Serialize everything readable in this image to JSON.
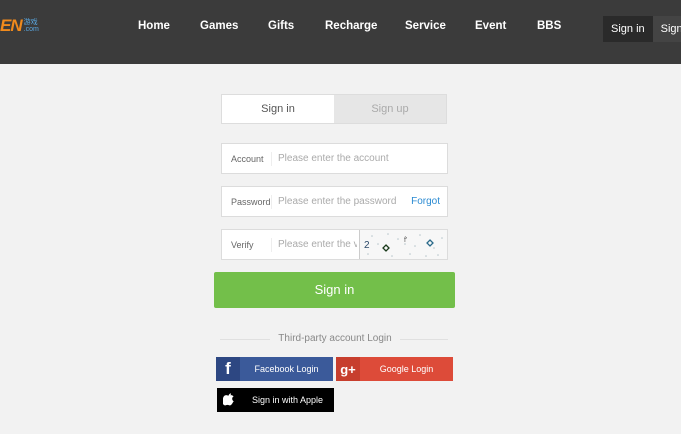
{
  "header": {
    "logo_text": "EN",
    "logo_sub": [
      "游戏",
      ".com"
    ],
    "nav": [
      "Home",
      "Games",
      "Gifts",
      "Recharge",
      "Service",
      "Event",
      "BBS"
    ],
    "signin_label": "Sign in",
    "signup_label": "Sign up"
  },
  "tabs": {
    "signin": "Sign in",
    "signup": "Sign up"
  },
  "form": {
    "account_label": "Account",
    "account_placeholder": "Please enter the account",
    "password_label": "Password",
    "password_placeholder": "Please enter the password",
    "forgot_label": "Forgot",
    "verify_label": "Verify",
    "verify_placeholder": "Please enter the verification code",
    "submit_label": "Sign in"
  },
  "third_party": {
    "label": "Third-party account Login",
    "facebook": "Facebook Login",
    "google": "Google Login",
    "apple": "Sign in with Apple",
    "google_icon": "g+"
  },
  "colors": {
    "header_bg": "#3b3b3b",
    "submit_green": "#73bf4a",
    "facebook_blue": "#3b5a9a",
    "google_red": "#dd4b39",
    "link_blue": "#2a8ad2"
  }
}
